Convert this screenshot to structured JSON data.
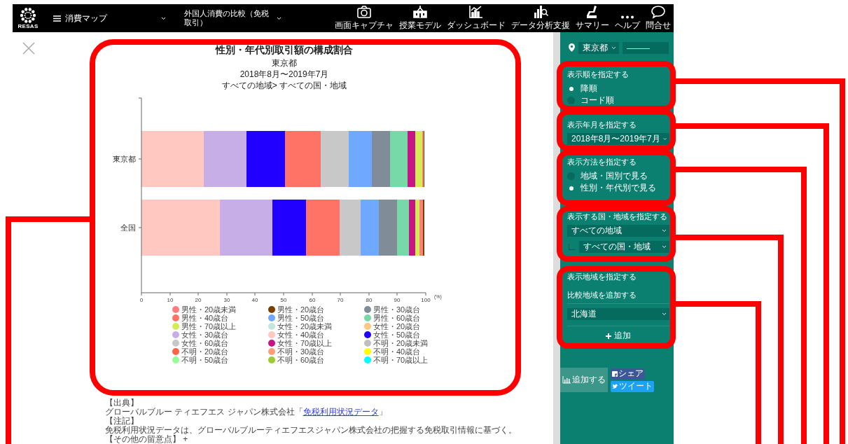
{
  "header": {
    "logo": "RESAS",
    "menu": {
      "label": "消費マップ"
    },
    "page_select": {
      "label": "外国人消費の比較（免税取引）"
    },
    "toolbar": [
      {
        "kind": "camera",
        "label": "画面キャプチャ"
      },
      {
        "kind": "school",
        "label": "授業モデル"
      },
      {
        "kind": "dashboard",
        "label": "ダッシュボード"
      },
      {
        "kind": "analysis",
        "label": "データ分析支援"
      },
      {
        "kind": "summary",
        "label": "サマリー"
      },
      {
        "kind": "help",
        "label": "ヘルプ"
      },
      {
        "kind": "contact",
        "label": "問合せ"
      }
    ]
  },
  "chart_card": {
    "title": "性別・年代別取引額の構成割合",
    "subtitles": [
      "東京都",
      "2018年8月〜2019年7月",
      "すべての地域> すべての国・地域"
    ],
    "chart_data": {
      "type": "bar",
      "orientation": "horizontal",
      "stacked": true,
      "xlabel": "(%)",
      "categories": [
        "東京都",
        "全国"
      ],
      "xlim": [
        0,
        100
      ],
      "xticks": [
        0,
        10,
        20,
        30,
        40,
        50,
        60,
        70,
        80,
        90,
        100
      ],
      "series": [
        {
          "name": "男性・20歳未満",
          "color": "#ff7f7f",
          "values": [
            0.4,
            1.2
          ]
        },
        {
          "name": "男性・20歳台",
          "color": "#7b3f00",
          "values": [
            0.3,
            0.5
          ]
        },
        {
          "name": "男性・30歳台",
          "color": "#808d99",
          "values": [
            6.5,
            6.3
          ]
        },
        {
          "name": "男性・40歳台",
          "color": "#ff7366",
          "values": [
            12.5,
            11.8
          ]
        },
        {
          "name": "男性・50歳台",
          "color": "#6ea8ff",
          "values": [
            8,
            6.5
          ]
        },
        {
          "name": "男性・60歳台",
          "color": "#77d9a8",
          "values": [
            6,
            4.2
          ]
        },
        {
          "name": "男性・70歳以上",
          "color": "#d4ed55",
          "values": [
            2.5,
            1.5
          ]
        },
        {
          "name": "女性・20歳未満",
          "color": "#c2e5e0",
          "values": [
            0,
            0
          ]
        },
        {
          "name": "女性・20歳台",
          "color": "#ffc680",
          "values": [
            0,
            0
          ]
        },
        {
          "name": "女性・30歳台",
          "color": "#c8aee6",
          "values": [
            15,
            18.3
          ]
        },
        {
          "name": "女性・40歳台",
          "color": "#ffc8c0",
          "values": [
            22,
            27.7
          ]
        },
        {
          "name": "女性・50歳台",
          "color": "#2200ff",
          "values": [
            13.5,
            11.8
          ]
        },
        {
          "name": "女性・60歳台",
          "color": "#c8c8c8",
          "values": [
            10,
            7.4
          ]
        },
        {
          "name": "女性・70歳以上",
          "color": "#c71585",
          "values": [
            2.8,
            2.3
          ]
        },
        {
          "name": "不明・20歳未満",
          "color": "#bfbfbf",
          "values": [
            0,
            0
          ]
        },
        {
          "name": "不明・20歳台",
          "color": "#ff6347",
          "values": [
            0,
            0
          ]
        },
        {
          "name": "不明・30歳台",
          "color": "#ff9f7a",
          "values": [
            0,
            0
          ]
        },
        {
          "name": "不明・40歳台",
          "color": "#ffff00",
          "values": [
            0,
            0
          ]
        },
        {
          "name": "不明・50歳台",
          "color": "#98fb98",
          "values": [
            0,
            0
          ]
        },
        {
          "name": "不明・60歳台",
          "color": "#9acd32",
          "values": [
            0,
            0
          ]
        },
        {
          "name": "不明・70歳以上",
          "color": "#00ffff",
          "values": [
            0,
            0
          ]
        }
      ]
    }
  },
  "notes": [
    {
      "kind": "heading",
      "text": "【出典】"
    },
    {
      "kind": "source",
      "text": "グローバルブルー ティエフエス ジャパン株式会社「",
      "link": "免税利用状況データ",
      "text_after": "」"
    },
    {
      "kind": "heading",
      "text": "【注記】"
    },
    {
      "kind": "text",
      "text": "免税利用状況データは、グローバルブルーティエフエスジャパン株式会社の把握する免税取引情報に基づく。"
    },
    {
      "kind": "toggle",
      "text": "【その他の留意点】 +"
    }
  ],
  "sidebar": {
    "location": {
      "prefecture": "東京都",
      "city": "———"
    },
    "sections": [
      {
        "kind": "radio",
        "title": "表示順を指定する",
        "options": [
          {
            "label": "降順",
            "selected": true
          },
          {
            "label": "コード順",
            "selected": false
          }
        ]
      },
      {
        "kind": "select",
        "title": "表示年月を指定する",
        "value": "2018年8月〜2019年7月"
      },
      {
        "kind": "radio",
        "title": "表示方法を指定する",
        "options": [
          {
            "label": "地域・国別で見る",
            "selected": false
          },
          {
            "label": "性別・年代別で見る",
            "selected": true
          }
        ]
      },
      {
        "kind": "nested_select",
        "title": "表示する国・地域を指定する",
        "value": "すべての地域",
        "child_value": "すべての国・地域"
      },
      {
        "kind": "add_region",
        "title": "表示地域を指定する",
        "subtitle": "比較地域を追加する",
        "value": "北海道",
        "button": "追加"
      }
    ],
    "footer": {
      "add_tab": "追加する",
      "share": "シェア",
      "tweet": "ツイート"
    }
  }
}
